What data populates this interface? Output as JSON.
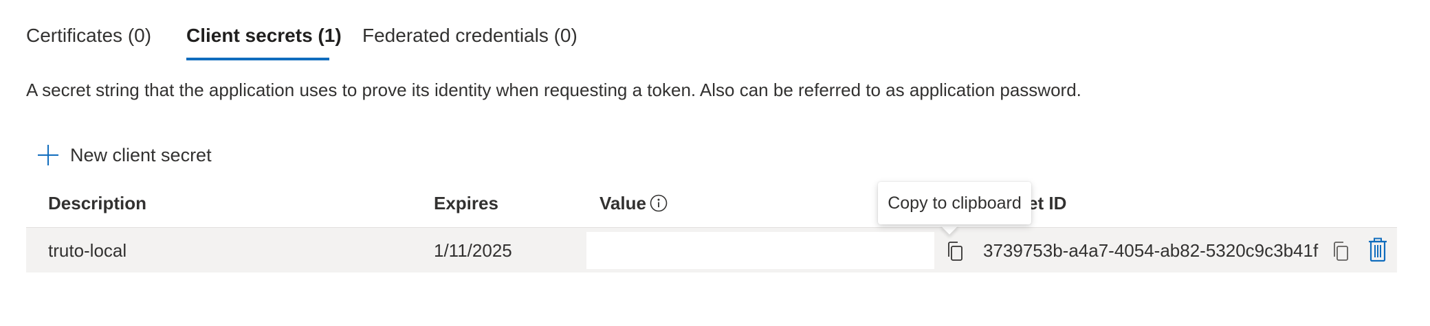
{
  "tabs": [
    {
      "label": "Certificates (0)"
    },
    {
      "label": "Client secrets (1)",
      "active": true
    },
    {
      "label": "Federated credentials (0)"
    }
  ],
  "description": "A secret string that the application uses to prove its identity when requesting a token. Also can be referred to as application password.",
  "toolbar": {
    "new_secret_label": "New client secret",
    "new_secret_icon": "plus-icon"
  },
  "table": {
    "headers": {
      "description": "Description",
      "expires": "Expires",
      "value": "Value",
      "secret_id": "et ID"
    },
    "rows": [
      {
        "description": "truto-local",
        "expires": "1/11/2025",
        "value": "",
        "secret_id": "3739753b-a4a7-4054-ab82-5320c9c3b41f"
      }
    ]
  },
  "tooltip": {
    "text": "Copy to clipboard"
  },
  "colors": {
    "accent": "#0f6cbd",
    "row_background": "#f3f2f1",
    "text": "#323130"
  }
}
